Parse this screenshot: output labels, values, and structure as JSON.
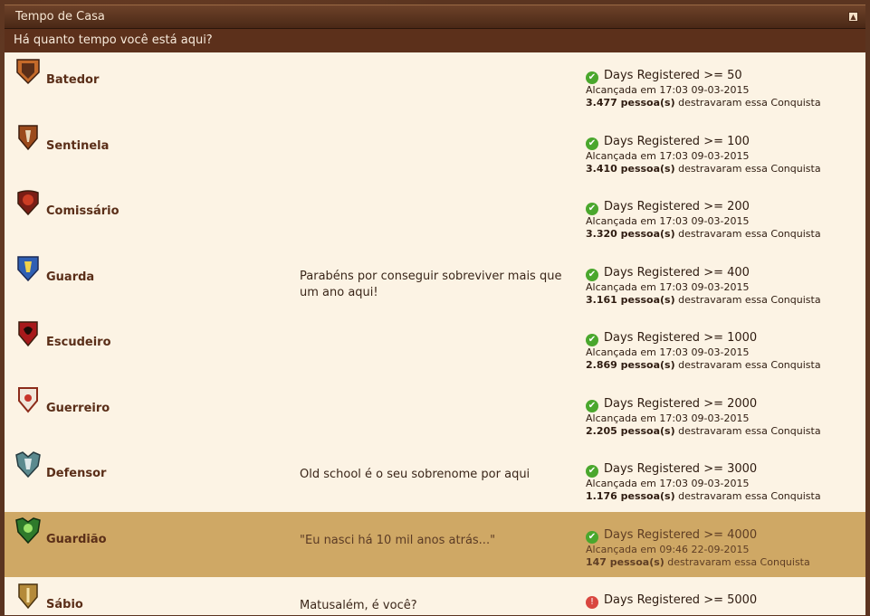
{
  "window": {
    "title": "Tempo de Casa",
    "subtitle": "Há quanto tempo você está aqui?"
  },
  "achievements": [
    {
      "name": "Batedor",
      "desc": "",
      "requirement": "Days Registered >= 50",
      "reached": "Alcançada em 17:03 09-03-2015",
      "count": "3.477 pessoa(s)",
      "count_suffix": " destravaram essa Conquista"
    },
    {
      "name": "Sentinela",
      "desc": "",
      "requirement": "Days Registered >= 100",
      "reached": "Alcançada em 17:03 09-03-2015",
      "count": "3.410 pessoa(s)",
      "count_suffix": " destravaram essa Conquista"
    },
    {
      "name": "Comissário",
      "desc": "",
      "requirement": "Days Registered >= 200",
      "reached": "Alcançada em 17:03 09-03-2015",
      "count": "3.320 pessoa(s)",
      "count_suffix": " destravaram essa Conquista"
    },
    {
      "name": "Guarda",
      "desc": "Parabéns por conseguir sobreviver mais que um ano aqui!",
      "requirement": "Days Registered >= 400",
      "reached": "Alcançada em 17:03 09-03-2015",
      "count": "3.161 pessoa(s)",
      "count_suffix": " destravaram essa Conquista"
    },
    {
      "name": "Escudeiro",
      "desc": "",
      "requirement": "Days Registered >= 1000",
      "reached": "Alcançada em 17:03 09-03-2015",
      "count": "2.869 pessoa(s)",
      "count_suffix": " destravaram essa Conquista"
    },
    {
      "name": "Guerreiro",
      "desc": "",
      "requirement": "Days Registered >= 2000",
      "reached": "Alcançada em 17:03 09-03-2015",
      "count": "2.205 pessoa(s)",
      "count_suffix": " destravaram essa Conquista"
    },
    {
      "name": "Defensor",
      "desc": "Old school é o seu sobrenome por aqui",
      "requirement": "Days Registered >= 3000",
      "reached": "Alcançada em 17:03 09-03-2015",
      "count": "1.176 pessoa(s)",
      "count_suffix": " destravaram essa Conquista"
    },
    {
      "name": "Guardião",
      "desc": "\"Eu nasci há 10 mil anos atrás...\"",
      "requirement": "Days Registered >= 4000",
      "reached": "Alcançada em 09:46 22-09-2015",
      "count": "147 pessoa(s)",
      "count_suffix": " destravaram essa Conquista"
    },
    {
      "name": "Sábio",
      "desc": "Matusalém, é você?",
      "requirement": "Days Registered >= 5000",
      "reached": "",
      "count": "",
      "count_suffix": ""
    }
  ],
  "colors": {
    "accent": "#5c301b",
    "highlight": "#cfa865",
    "success": "#4aa72d",
    "failure": "#d9463f"
  },
  "icons": {
    "ok": "check-circle-icon",
    "fail": "alert-circle-icon"
  }
}
